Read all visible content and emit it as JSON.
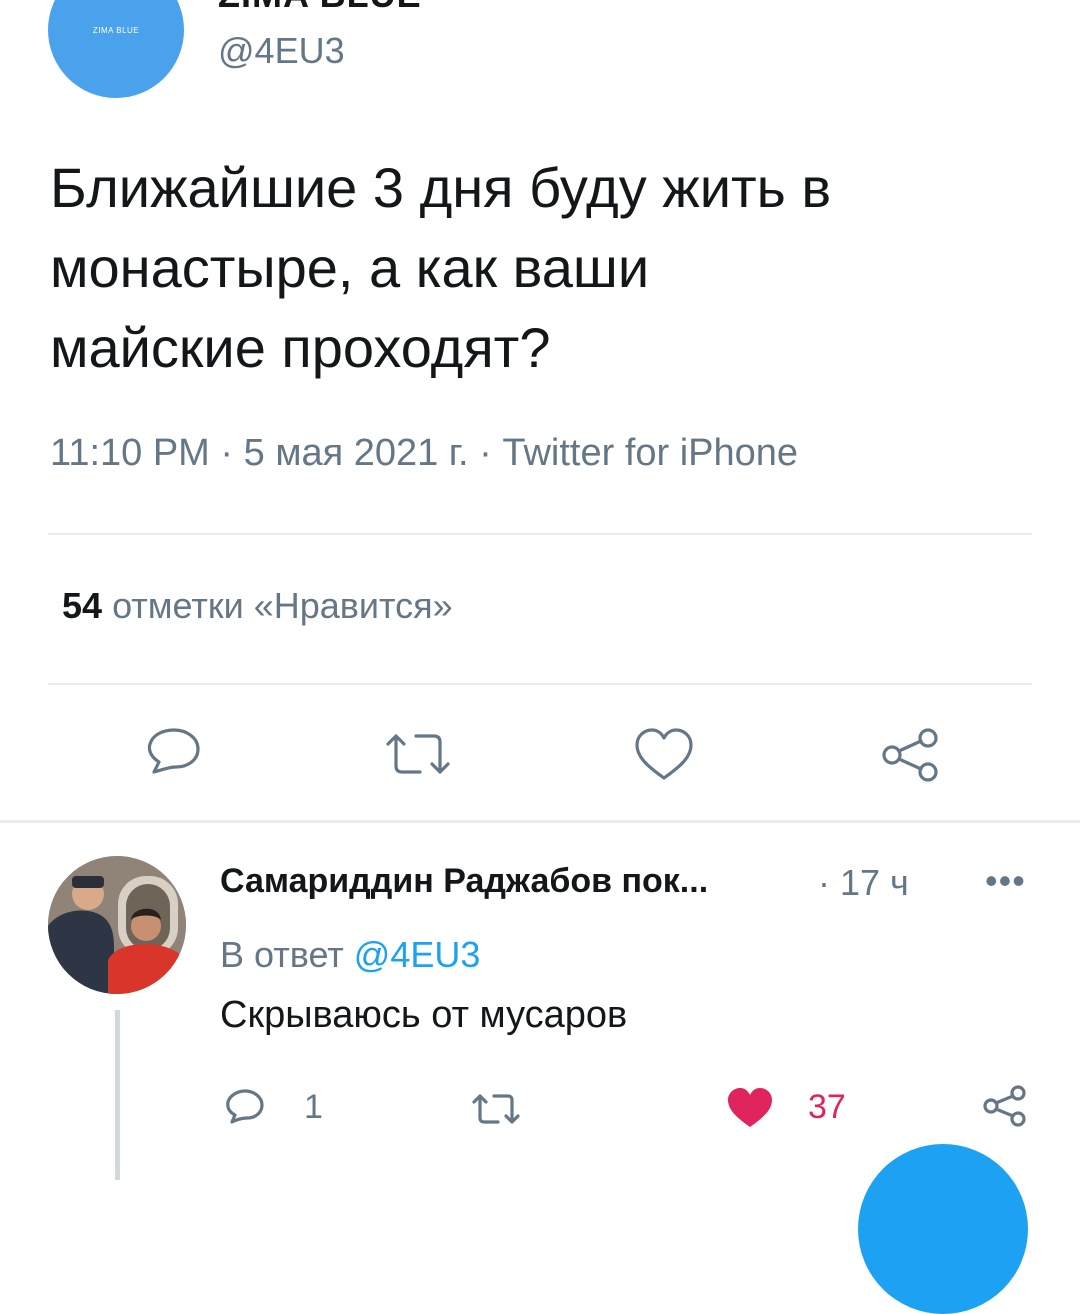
{
  "tweet": {
    "avatar_label": "ZIMA BLUE",
    "display_name": "ZIMA BLUE",
    "handle": "@4EU3",
    "text": "Ближайшие 3 дня буду жить в\nмонастыре, а как ваши\nмайские проходят?",
    "time": "11:10 PM",
    "date": "5 мая 2021 г.",
    "source": "Twitter for iPhone",
    "likes_count": "54",
    "likes_label": "отметки «Нравится»",
    "separator": " · "
  },
  "actions": [
    "reply-icon",
    "retweet-icon",
    "like-icon",
    "share-icon"
  ],
  "reply": {
    "name": "Самариддин Раджабов пок...",
    "time": "· 17 ч",
    "more": "•••",
    "reply_to_prefix": "В ответ",
    "reply_to_mention": "@4EU3",
    "text": "Скрываюсь от мусаров",
    "reply_count": "1",
    "retweet_count": "",
    "like_count": "37",
    "liked": true
  },
  "colors": {
    "accent": "#1da1f2",
    "muted": "#657786",
    "like": "#e0245e",
    "avatar": "#4aa1ec"
  }
}
